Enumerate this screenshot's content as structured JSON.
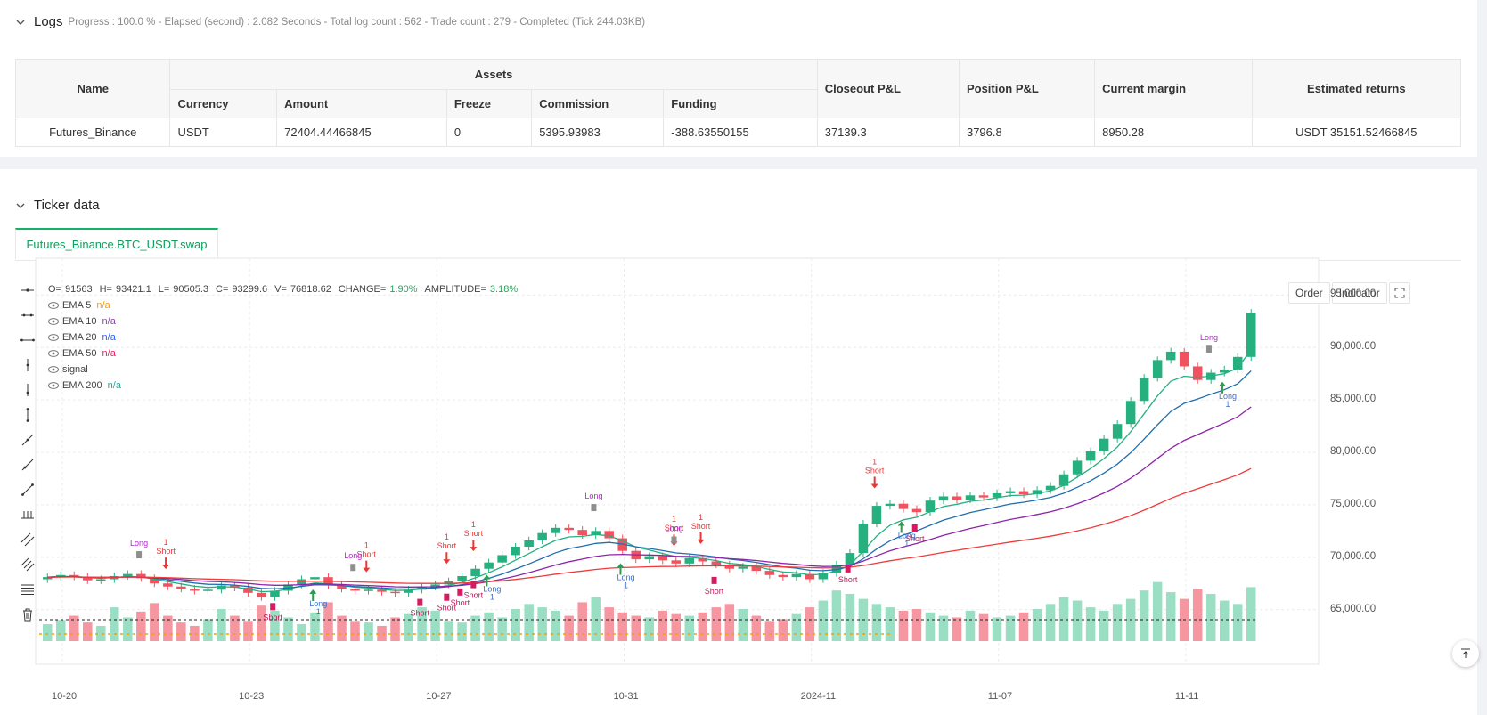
{
  "logs": {
    "title": "Logs",
    "status": "Progress : 100.0 % - Elapsed (second) : 2.082 Seconds - Total log count : 562 - Trade count : 279 - Completed (Tick 244.03KB)"
  },
  "assets_table": {
    "headers": {
      "name": "Name",
      "assets": "Assets",
      "currency": "Currency",
      "amount": "Amount",
      "freeze": "Freeze",
      "commission": "Commission",
      "funding": "Funding",
      "closeout_pnl": "Closeout P&L",
      "position_pnl": "Position P&L",
      "current_margin": "Current margin",
      "estimated_returns": "Estimated returns"
    },
    "row": {
      "name": "Futures_Binance",
      "currency": "USDT",
      "amount": "72404.44466845",
      "freeze": "0",
      "commission": "5395.93983",
      "funding": "-388.63550155",
      "closeout_pnl": "37139.3",
      "position_pnl": "3796.8",
      "current_margin": "8950.28",
      "estimated_returns": "USDT 35151.52466845"
    }
  },
  "ticker": {
    "title": "Ticker data",
    "tab": "Futures_Binance.BTC_USDT.swap"
  },
  "chart": {
    "buttons": {
      "order": "Order",
      "indicator": "Indicator"
    },
    "ohlc": {
      "o_label": "O=",
      "o": "91563",
      "h_label": "H=",
      "h": "93421.1",
      "l_label": "L=",
      "l": "90505.3",
      "c_label": "C=",
      "c": "93299.6",
      "v_label": "V=",
      "v": "76818.62",
      "change_label": "CHANGE=",
      "change": "1.90%",
      "amp_label": "AMPLITUDE=",
      "amp": "3.18%"
    },
    "legend": [
      {
        "name": "EMA 5",
        "value": "n/a",
        "color": "#f39c12"
      },
      {
        "name": "EMA 10",
        "value": "n/a",
        "color": "#8e44ad"
      },
      {
        "name": "EMA 20",
        "value": "n/a",
        "color": "#2962ff"
      },
      {
        "name": "EMA 50",
        "value": "n/a",
        "color": "#e91e63"
      },
      {
        "name": "signal",
        "value": "",
        "color": "#555555"
      },
      {
        "name": "EMA 200",
        "value": "n/a",
        "color": "#26a69a"
      }
    ],
    "y_ticks": [
      "95,000.00",
      "90,000.00",
      "85,000.00",
      "80,000.00",
      "75,000.00",
      "70,000.00",
      "65,000.00"
    ],
    "x_ticks": [
      "10-20",
      "10-23",
      "10-27",
      "10-31",
      "2024-11",
      "11-07",
      "11-11"
    ],
    "colors": {
      "up": "#26b07f",
      "down": "#f0535f",
      "ema_fast": "#26b07f",
      "ema_mid": "#1f6fb0",
      "ema_slow": "#8e24aa",
      "ema_long": "#ef3b3b"
    },
    "signal_labels": {
      "long": "Long",
      "short": "Short",
      "one": "1"
    }
  },
  "chart_data": {
    "type": "candlestick",
    "y_range": [
      62000,
      98000
    ],
    "close_series": [
      68100,
      68300,
      68150,
      67800,
      67900,
      68200,
      68400,
      68000,
      67500,
      67200,
      67000,
      66800,
      66900,
      67300,
      67100,
      66600,
      66200,
      66800,
      67400,
      67900,
      68100,
      67300,
      67000,
      66800,
      66900,
      66700,
      66600,
      66900,
      67200,
      67400,
      67700,
      68200,
      68900,
      69500,
      70200,
      71000,
      71600,
      72300,
      72800,
      72600,
      72100,
      72500,
      71800,
      70600,
      69800,
      70100,
      69700,
      69400,
      69900,
      69600,
      69300,
      68900,
      69100,
      68700,
      68300,
      68100,
      68400,
      67900,
      68500,
      69300,
      70400,
      73200,
      74900,
      75100,
      74600,
      74300,
      75400,
      75800,
      75500,
      75900,
      75700,
      76100,
      76300,
      76000,
      76400,
      76800,
      77900,
      79200,
      80100,
      81300,
      82700,
      84900,
      87100,
      88800,
      89600,
      88200,
      86900,
      87600,
      87900,
      89100,
      93300
    ],
    "volume_series": [
      20,
      25,
      30,
      22,
      18,
      40,
      28,
      35,
      45,
      30,
      22,
      18,
      26,
      38,
      30,
      24,
      42,
      36,
      28,
      20,
      34,
      46,
      30,
      24,
      22,
      18,
      28,
      32,
      40,
      36,
      24,
      22,
      30,
      34,
      28,
      38,
      44,
      40,
      36,
      30,
      46,
      52,
      40,
      34,
      30,
      28,
      36,
      32,
      30,
      34,
      40,
      44,
      38,
      30,
      24,
      26,
      32,
      40,
      48,
      60,
      56,
      50,
      44,
      40,
      36,
      38,
      34,
      30,
      28,
      36,
      32,
      28,
      30,
      34,
      38,
      44,
      52,
      48,
      40,
      36,
      44,
      50,
      60,
      70,
      58,
      50,
      62,
      56,
      48,
      44,
      64
    ]
  }
}
